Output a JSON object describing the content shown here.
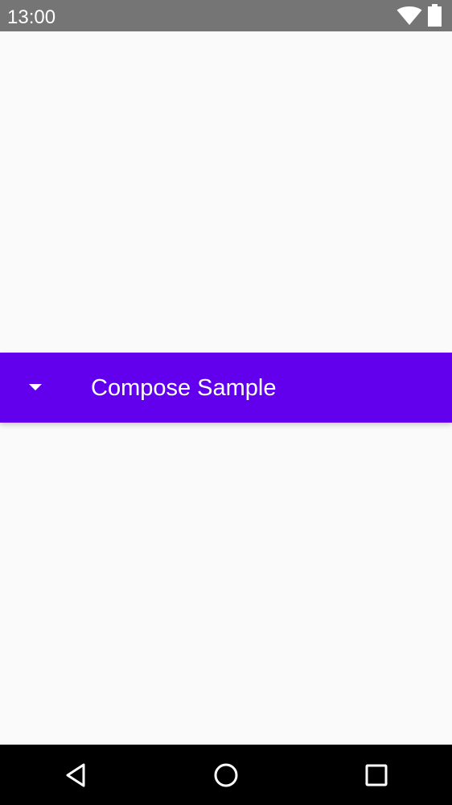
{
  "status_bar": {
    "time": "13:00",
    "icons": [
      "wifi-icon",
      "battery-icon"
    ]
  },
  "app_bar": {
    "title": "Compose Sample",
    "menu_icon": "arrow-drop-down-icon",
    "background_color": "#6200ee",
    "text_color": "#ffffff"
  },
  "nav_bar": {
    "buttons": [
      "back-icon",
      "home-icon",
      "recents-icon"
    ]
  },
  "colors": {
    "status_bar": "#757575",
    "background": "#fafafa",
    "nav_bar": "#000000"
  }
}
